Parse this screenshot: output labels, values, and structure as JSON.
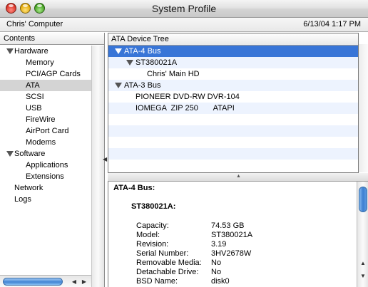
{
  "window": {
    "title": "System Profile"
  },
  "info": {
    "computer": "Chris' Computer",
    "datetime": "6/13/04 1:17 PM"
  },
  "sidebar": {
    "header": "Contents",
    "items": [
      {
        "label": "Hardware",
        "group": true
      },
      {
        "label": "Memory"
      },
      {
        "label": "PCI/AGP Cards"
      },
      {
        "label": "ATA",
        "selected": true
      },
      {
        "label": "SCSI"
      },
      {
        "label": "USB"
      },
      {
        "label": "FireWire"
      },
      {
        "label": "AirPort Card"
      },
      {
        "label": "Modems"
      },
      {
        "label": "Software",
        "group": true
      },
      {
        "label": "Applications"
      },
      {
        "label": "Extensions"
      },
      {
        "label": "Network",
        "top": true
      },
      {
        "label": "Logs",
        "top": true
      }
    ]
  },
  "tree": {
    "header": "ATA Device Tree",
    "rows": [
      {
        "text": "ATA-4 Bus",
        "level": 0,
        "expanded": true,
        "selected": true
      },
      {
        "text": "ST380021A",
        "level": 1,
        "expanded": true
      },
      {
        "text": "Chris' Main HD",
        "level": 2
      },
      {
        "text": "ATA-3 Bus",
        "level": 0,
        "expanded": true
      },
      {
        "text": "PIONEER DVD-RW  DVR-104",
        "level": 1
      },
      {
        "text": "IOMEGA  ZIP 250       ATAPI",
        "level": 1
      }
    ]
  },
  "detail": {
    "bus_title": "ATA-4 Bus:",
    "device_title": "ST380021A:",
    "properties": [
      {
        "label": "Capacity:",
        "value": "74.53 GB"
      },
      {
        "label": "Model:",
        "value": "ST380021A"
      },
      {
        "label": "Revision:",
        "value": "3.19"
      },
      {
        "label": "Serial Number:",
        "value": "3HV2678W"
      },
      {
        "label": "Removable Media:",
        "value": "No"
      },
      {
        "label": "Detachable Drive:",
        "value": "No"
      },
      {
        "label": "BSD Name:",
        "value": "disk0"
      }
    ]
  },
  "colors": {
    "selection": "#3875d7",
    "sidebar_selection": "#d4d4d4",
    "row_stripe": "#edf3fe"
  }
}
